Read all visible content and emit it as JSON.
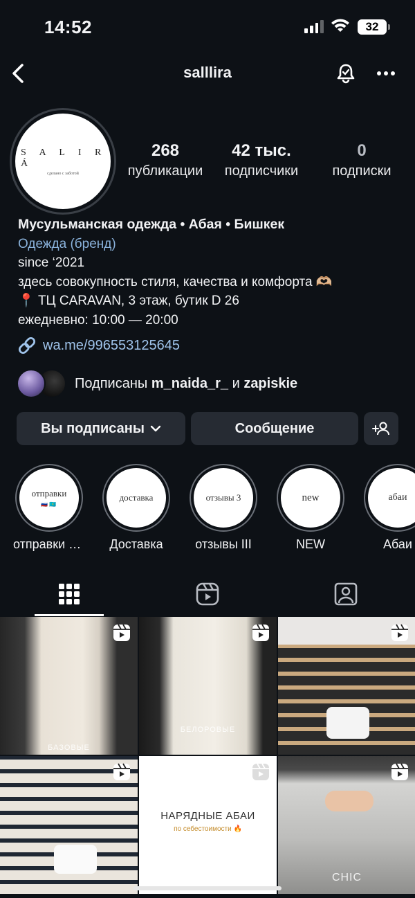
{
  "status_bar": {
    "time": "14:52",
    "battery": "32"
  },
  "header": {
    "username": "salllira"
  },
  "profile": {
    "avatar": {
      "logo_text": "S A L I R Á",
      "tagline": "сделано с заботой"
    },
    "stats": [
      {
        "value": "268",
        "label": "публикации"
      },
      {
        "value": "42 тыс.",
        "label": "подписчики"
      },
      {
        "value": "0",
        "label": "подписки"
      }
    ],
    "bio": {
      "name": "Мусульманская одежда • Абая • Бишкек",
      "category": "Одежда (бренд)",
      "line1": "since ‘2021",
      "line2": "здесь совокупность стиля, качества и комфорта 🫶🏼",
      "line3": "ТЦ CARAVAN, 3 этаж, бутик D 26",
      "line4": "ежедневно: 10:00 — 20:00",
      "link": "wa.me/996553125645"
    },
    "followed_by": {
      "prefix": "Подписаны",
      "user1": "m_naida_r_",
      "joiner": "и",
      "user2": "zapiskie"
    }
  },
  "actions": {
    "following_label": "Вы подписаны",
    "message_label": "Сообщение"
  },
  "highlights": [
    {
      "cover": "отправки",
      "label": "отправки п..."
    },
    {
      "cover": "доставка",
      "label": "Доставка"
    },
    {
      "cover": "отзывы 3",
      "label": "отзывы III"
    },
    {
      "cover": "new",
      "label": "NEW"
    },
    {
      "cover": "абаи",
      "label": "Абаи"
    }
  ],
  "grid": {
    "c1_caption": "БАЗОВЫЕ",
    "c2_caption": "БЕЛОРОВЫЕ",
    "c5_title": "НАРЯДНЫЕ АБАИ",
    "c5_subtitle": "по себестоимости 🔥",
    "c6_caption": "CHIC"
  },
  "colors": {
    "background": "#0d1116",
    "link": "#9fc3ea",
    "category": "#8ab2db",
    "button_bg": "#262b33"
  }
}
